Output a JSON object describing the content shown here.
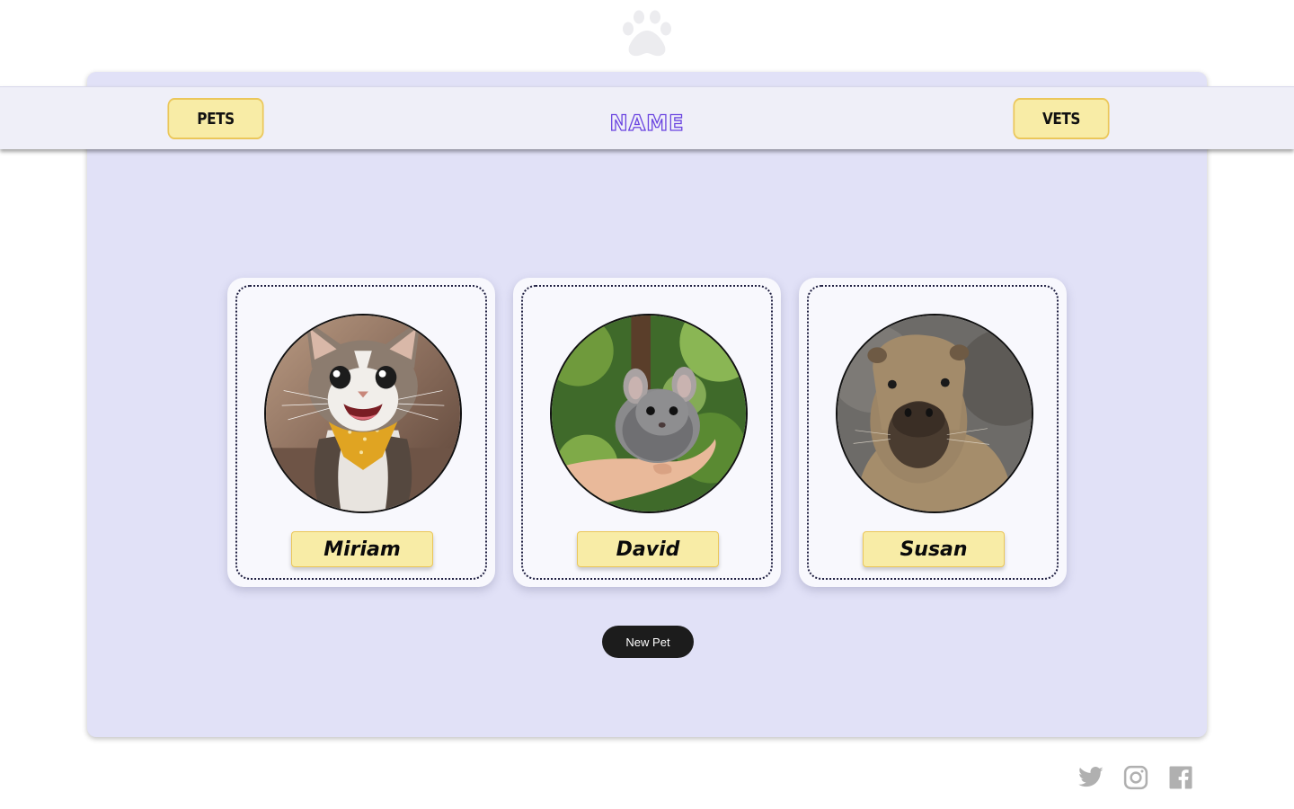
{
  "header": {
    "brand": "NAME",
    "logo_icon": "paw-icon"
  },
  "nav": {
    "pets_label": "PETS",
    "vets_label": "VETS"
  },
  "pets": [
    {
      "name": "Miriam",
      "photo": "cat-photo"
    },
    {
      "name": "David",
      "photo": "chinchilla-photo"
    },
    {
      "name": "Susan",
      "photo": "capybara-photo"
    }
  ],
  "actions": {
    "new_pet_label": "New Pet"
  },
  "footer": {
    "social_icons": [
      "twitter-icon",
      "instagram-icon",
      "facebook-icon"
    ]
  },
  "colors": {
    "panel": "#e1e1f7",
    "navbar": "#efeff8",
    "button_fill": "#f8eca6",
    "button_border": "#ebc75a",
    "brand_outline": "#6a44e0",
    "new_pet_button": "#1c1c1c",
    "icon_gray": "#b0b0b0"
  }
}
